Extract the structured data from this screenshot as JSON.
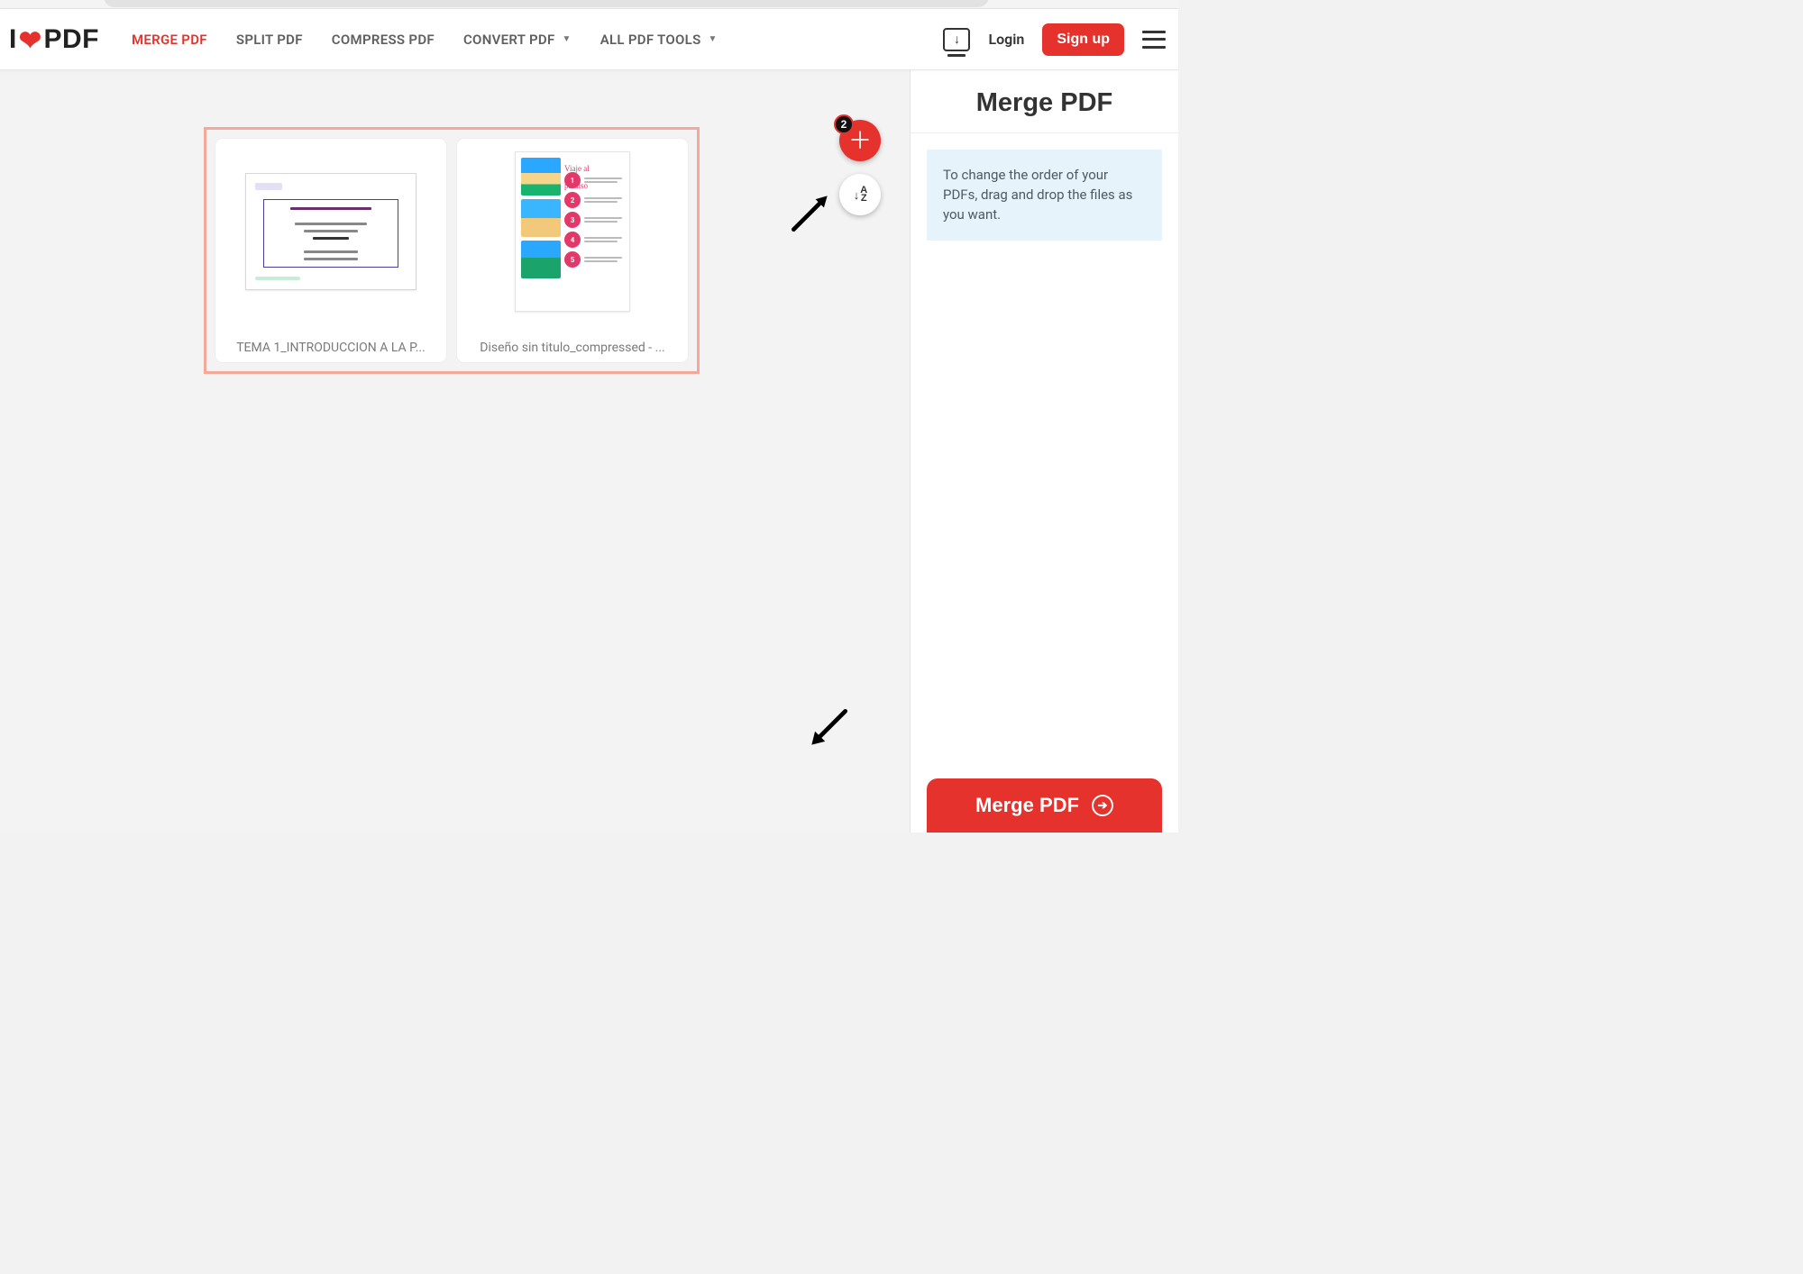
{
  "brand": {
    "left": "I",
    "right": "PDF"
  },
  "nav": {
    "merge": "MERGE PDF",
    "split": "SPLIT PDF",
    "compress": "COMPRESS PDF",
    "convert": "CONVERT PDF",
    "all": "ALL PDF TOOLS"
  },
  "header": {
    "login": "Login",
    "signup": "Sign up"
  },
  "files": {
    "count": "2",
    "items": [
      {
        "label": "TEMA 1_INTRODUCCION A LA P..."
      },
      {
        "label": "Diseño sin titulo_compressed - ..."
      }
    ]
  },
  "panel": {
    "title": "Merge PDF",
    "info": "To change the order of your PDFs, drag and drop the files as you want.",
    "action": "Merge PDF"
  }
}
